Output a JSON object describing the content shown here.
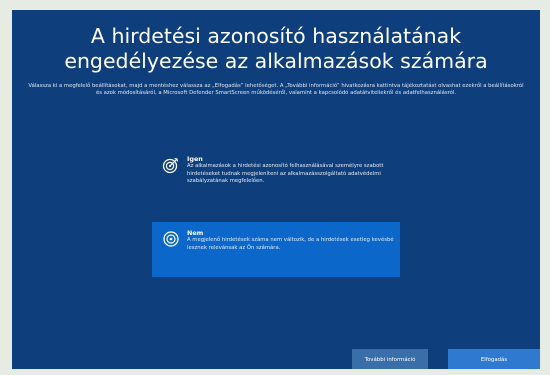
{
  "page": {
    "title_line1": "A hirdetési azonosító használatának",
    "title_line2": "engedélyezése az alkalmazások számára",
    "description": "Válassza ki a megfelelő beállításokat, majd a mentéshez válassza az „Elfogadás” lehetőséget. A „További információ” hivatkozásra kattintva tájékoztatást olvashat ezekről a beállításokról és azok módosításáról, a Microsoft Defender SmartScreen működéséről, valamint a kapcsolódó adatátviteli­ekről és adatfelhasználásról."
  },
  "options": [
    {
      "label": "Igen",
      "description": "Az alkalmazások a hirdetési azonosító felhasználásával személyre szabott hirdetéseket tudnak megjeleníteni az alkalmazásszolgáltató adatvédelmi szabályzatának megfelelően.",
      "icon": "target-icon",
      "selected": false
    },
    {
      "label": "Nem",
      "description": "A megjelenő hirdetések száma nem változik, de a hirdetések esetleg kevésbé lesznek relevánsak az Ön számára.",
      "icon": "target-icon",
      "selected": true
    }
  ],
  "buttons": {
    "more_info": "További információ",
    "accept": "Elfogadás"
  },
  "colors": {
    "background": "#0e3f7c",
    "selected_option": "#0b67c9",
    "accept_button": "#2f7ad0",
    "more_info_button": "#3a6ea8"
  }
}
